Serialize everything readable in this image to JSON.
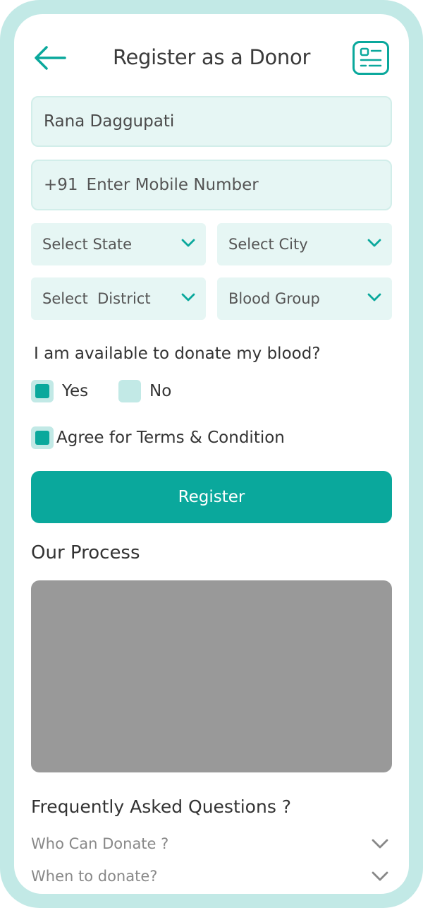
{
  "header": {
    "title": "Register as a Donor",
    "back_icon": "arrow-left-icon",
    "card_icon": "id-card-icon"
  },
  "form": {
    "name_value": "Rana Daggupati",
    "phone_prefix": "+91",
    "phone_placeholder": "Enter Mobile Number",
    "state_placeholder": "Select State",
    "city_placeholder": "Select City",
    "district_placeholder": "Select  District",
    "blood_group_placeholder": "Blood Group",
    "availability_question": "I am available to donate my blood?",
    "yes_label": "Yes",
    "no_label": "No",
    "yes_checked": true,
    "no_checked": false,
    "terms_label": "Agree for Terms & Condition",
    "terms_checked": true,
    "register_label": "Register"
  },
  "process": {
    "title": "Our Process"
  },
  "faq": {
    "title": "Frequently Asked Questions ?",
    "items": [
      {
        "question": "Who Can Donate ?"
      },
      {
        "question": "When to donate?"
      }
    ]
  },
  "colors": {
    "accent": "#0aa89c",
    "field_bg": "#e6f6f4",
    "frame": "#c2e9e6",
    "placeholder_image": "#999999"
  }
}
